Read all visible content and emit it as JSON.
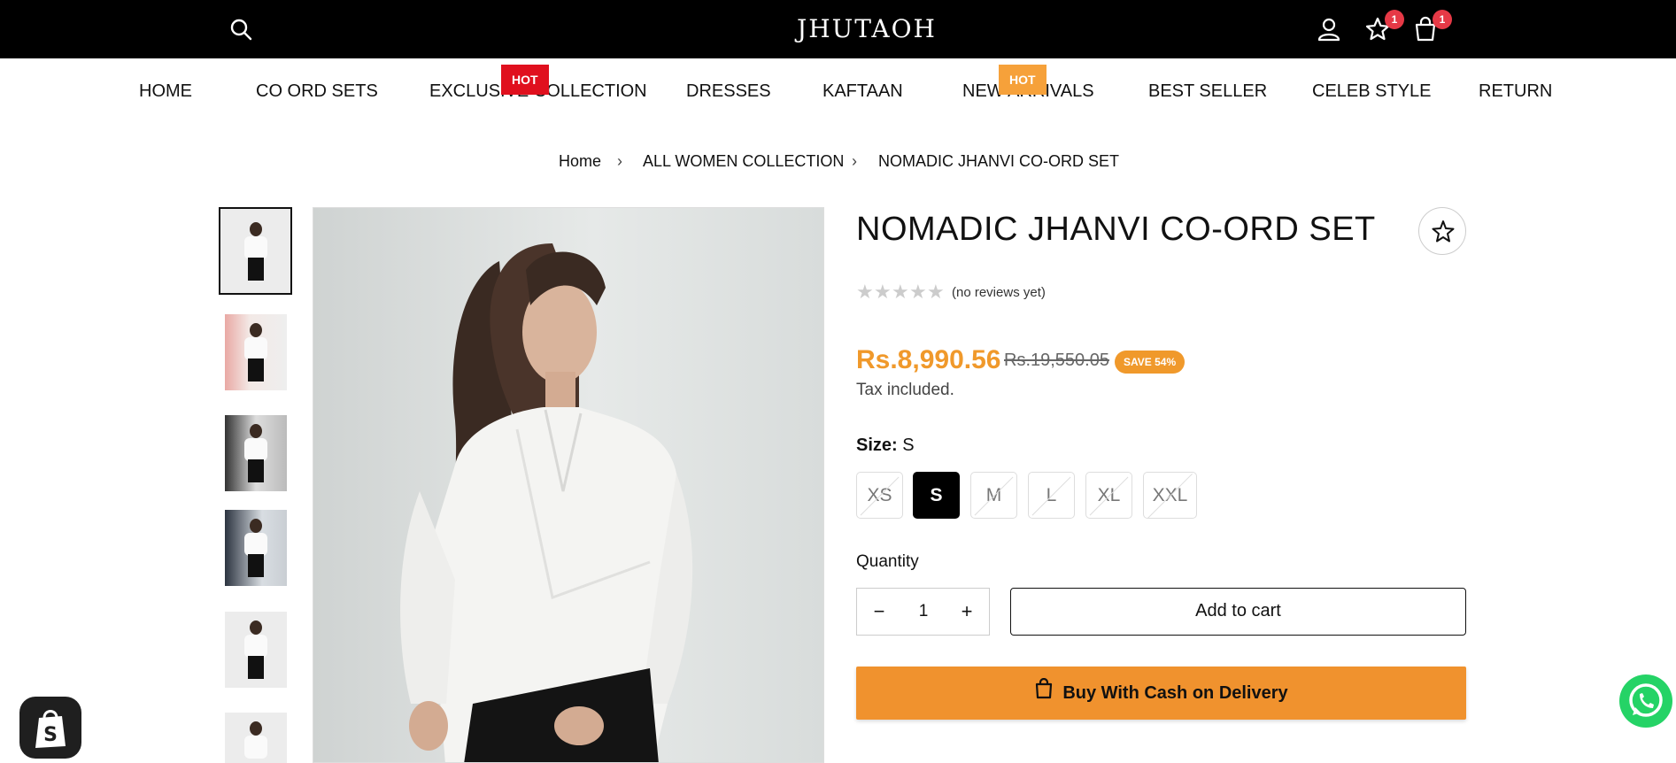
{
  "header": {
    "logo_text": "JHUTAOH",
    "wishlist_count": "1",
    "cart_count": "1"
  },
  "nav": {
    "items": [
      {
        "label": "HOME"
      },
      {
        "label": "CO ORD SETS"
      },
      {
        "label": "EXCLUSIVE COLLECTION",
        "tag": "HOT"
      },
      {
        "label": "DRESSES"
      },
      {
        "label": "KAFTAAN"
      },
      {
        "label": "NEW ARRIVALS",
        "tag": "HOT"
      },
      {
        "label": "BEST SELLER"
      },
      {
        "label": "CELEB STYLE"
      },
      {
        "label": "RETURN"
      }
    ],
    "tag_colors": {
      "red": "#e0101e",
      "orange": "#f6a13a"
    }
  },
  "breadcrumb": {
    "items": [
      "Home",
      "ALL WOMEN COLLECTION",
      "NOMADIC JHANVI CO-ORD SET"
    ],
    "separator": "›"
  },
  "product": {
    "title": "NOMADIC JHANVI CO-ORD SET",
    "rating": 0,
    "reviews_text": "(no reviews yet)",
    "price": "Rs.8,990.56",
    "compare_price": "Rs.19,550.05",
    "save_badge": "SAVE 54%",
    "tax_note": "Tax included.",
    "size_label": "Size:",
    "selected_size": "S",
    "sizes": [
      "XS",
      "S",
      "M",
      "L",
      "XL",
      "XXL"
    ],
    "quantity_label": "Quantity",
    "quantity": "1",
    "qty_minus": "−",
    "qty_plus": "+",
    "add_to_cart": "Add to cart",
    "buy_cod": "Buy With Cash on Delivery",
    "accent_color": "#f0992b"
  },
  "thumbnails": {
    "count": 6,
    "active_index": 0
  }
}
